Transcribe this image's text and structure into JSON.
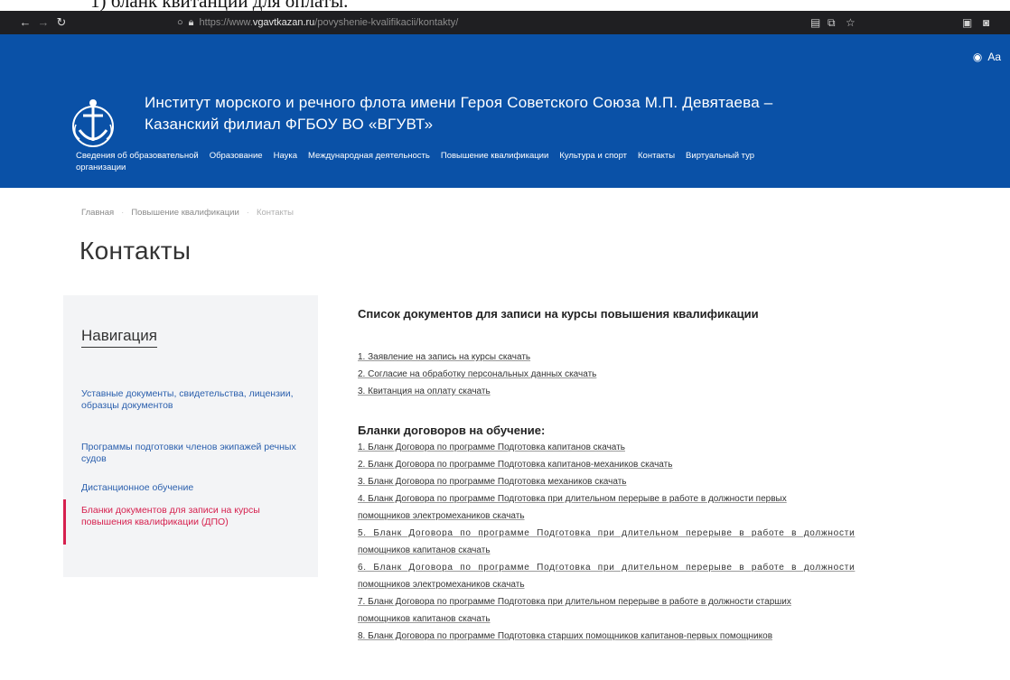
{
  "caption": "1) бланк квитанции для оплаты.",
  "browser": {
    "back_icon": "arrow-left-icon",
    "forward_icon": "arrow-right-icon",
    "reload_icon": "reload-icon",
    "url_prefix": "https://www.",
    "url_domain": "vgavtkazan.ru",
    "url_path": "/povyshenie-kvalifikacii/kontakty/"
  },
  "header": {
    "title_line1": "Институт морского и речного флота имени Героя Советского Союза М.П. Девятаева –",
    "title_line2": "Казанский филиал ФГБОУ ВО «ВГУВТ»",
    "font_size_label": "Aa",
    "nav": [
      "Сведения об образовательной",
      "Образование",
      "Наука",
      "Международная деятельность",
      "Повышение квалификации",
      "Культура и спорт",
      "Контакты",
      "Виртуальный тур"
    ],
    "nav_line2": "организации"
  },
  "breadcrumb": [
    "Главная",
    "Повышение квалификации",
    "Контакты"
  ],
  "page_title": "Контакты",
  "sidebar": {
    "title": "Навигация",
    "items": [
      {
        "label": "Уставные документы, свидетельства, лицензии, образцы документов",
        "active": false
      },
      {
        "label": "Программы подготовки членов экипажей речных судов",
        "active": false
      },
      {
        "label": "Дистанционное обучение",
        "active": false
      },
      {
        "label": "Бланки документов для записи на курсы повышения квалификации (ДПО)",
        "active": true
      }
    ]
  },
  "content": {
    "heading": "Список документов для записи на курсы повышения квалификации",
    "documents": [
      "1. Заявление на запись на курсы скачать",
      "2. Согласие на обработку персональных данных скачать",
      "3. Квитанция на оплату скачать"
    ],
    "contracts_heading": "Бланки договоров на обучение:",
    "contracts": [
      "1. Бланк Договора по программе Подготовка капитанов скачать",
      "2. Бланк Договора по программе Подготовка капитанов-механиков скачать",
      "3. Бланк Договора по программе Подготовка механиков скачать",
      "4. Бланк Договора по программе Подготовка при длительном перерыве в работе в должности первых",
      "помощников электромехаников скачать",
      "5. Бланк Договора по программе Подготовка при длительном перерыве в работе в должности",
      "помощников капитанов скачать",
      "6. Бланк Договора по программе Подготовка при длительном перерыве в работе в должности",
      "помощников электромехаников скачать",
      "7. Бланк Договора по программе Подготовка при длительном перерыве в работе в должности старших",
      "помощников капитанов скачать",
      "8. Бланк Договора по программе Подготовка старших помощников капитанов-первых помощников"
    ]
  },
  "colors": {
    "header_bg": "#0a51a7",
    "link": "#2a5fad",
    "active": "#d6204e",
    "sidebar_bg": "#f3f4f6"
  }
}
